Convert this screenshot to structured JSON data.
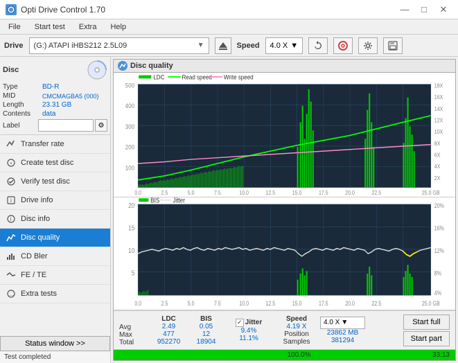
{
  "titleBar": {
    "title": "Opti Drive Control 1.70",
    "icon": "opti-icon",
    "controls": [
      "minimize",
      "maximize",
      "close"
    ]
  },
  "menuBar": {
    "items": [
      "File",
      "Start test",
      "Extra",
      "Help"
    ]
  },
  "driveBar": {
    "label": "Drive",
    "driveText": "(G:) ATAPI iHBS212  2.5L09",
    "speedLabel": "Speed",
    "speedValue": "4.0 X"
  },
  "disc": {
    "title": "Disc",
    "type_label": "Type",
    "type_value": "BD-R",
    "mid_label": "MID",
    "mid_value": "CMCMAGBA5 (000)",
    "length_label": "Length",
    "length_value": "23.31 GB",
    "contents_label": "Contents",
    "contents_value": "data",
    "label_label": "Label",
    "label_value": ""
  },
  "nav": {
    "items": [
      {
        "id": "transfer-rate",
        "label": "Transfer rate",
        "active": false
      },
      {
        "id": "create-test-disc",
        "label": "Create test disc",
        "active": false
      },
      {
        "id": "verify-test-disc",
        "label": "Verify test disc",
        "active": false
      },
      {
        "id": "drive-info",
        "label": "Drive info",
        "active": false
      },
      {
        "id": "disc-info",
        "label": "Disc info",
        "active": false
      },
      {
        "id": "disc-quality",
        "label": "Disc quality",
        "active": true
      },
      {
        "id": "cd-bler",
        "label": "CD Bler",
        "active": false
      },
      {
        "id": "fe-te",
        "label": "FE / TE",
        "active": false
      },
      {
        "id": "extra-tests",
        "label": "Extra tests",
        "active": false
      }
    ]
  },
  "statusWindow": {
    "button_label": "Status window >>",
    "status_text": "Test completed"
  },
  "qualityPanel": {
    "title": "Disc quality",
    "legend": {
      "ldc": "LDC",
      "read_speed": "Read speed",
      "write_speed": "Write speed",
      "bis": "BIS",
      "jitter": "Jitter"
    },
    "chart1": {
      "yMax": 500,
      "yLabels": [
        "500",
        "400",
        "300",
        "200",
        "100"
      ],
      "yLabelsRight": [
        "18X",
        "16X",
        "14X",
        "12X",
        "10X",
        "8X",
        "6X",
        "4X",
        "2X"
      ],
      "xLabels": [
        "0.0",
        "2.5",
        "5.0",
        "7.5",
        "10.0",
        "12.5",
        "15.0",
        "17.5",
        "20.0",
        "22.5",
        "25.0 GB"
      ]
    },
    "chart2": {
      "yMax": 20,
      "yLabels": [
        "20",
        "15",
        "10",
        "5"
      ],
      "yLabelsRight": [
        "20%",
        "16%",
        "12%",
        "8%",
        "4%"
      ],
      "xLabels": [
        "0.0",
        "2.5",
        "5.0",
        "7.5",
        "10.0",
        "12.5",
        "15.0",
        "17.5",
        "20.0",
        "22.5",
        "25.0 GB"
      ]
    },
    "stats": {
      "col_headers": [
        "LDC",
        "BIS",
        "",
        "Jitter",
        "Speed",
        ""
      ],
      "avg_label": "Avg",
      "avg_ldc": "2.49",
      "avg_bis": "0.05",
      "avg_jitter": "9.4%",
      "avg_speed": "4.19 X",
      "max_label": "Max",
      "max_ldc": "477",
      "max_bis": "12",
      "max_jitter": "11.1%",
      "position_label": "Position",
      "position_value": "23862 MB",
      "total_label": "Total",
      "total_ldc": "952270",
      "total_bis": "18904",
      "samples_label": "Samples",
      "samples_value": "381294",
      "speed_select": "4.0 X",
      "start_full": "Start full",
      "start_part": "Start part"
    },
    "progress": {
      "percent": 100,
      "time": "33:13"
    }
  }
}
